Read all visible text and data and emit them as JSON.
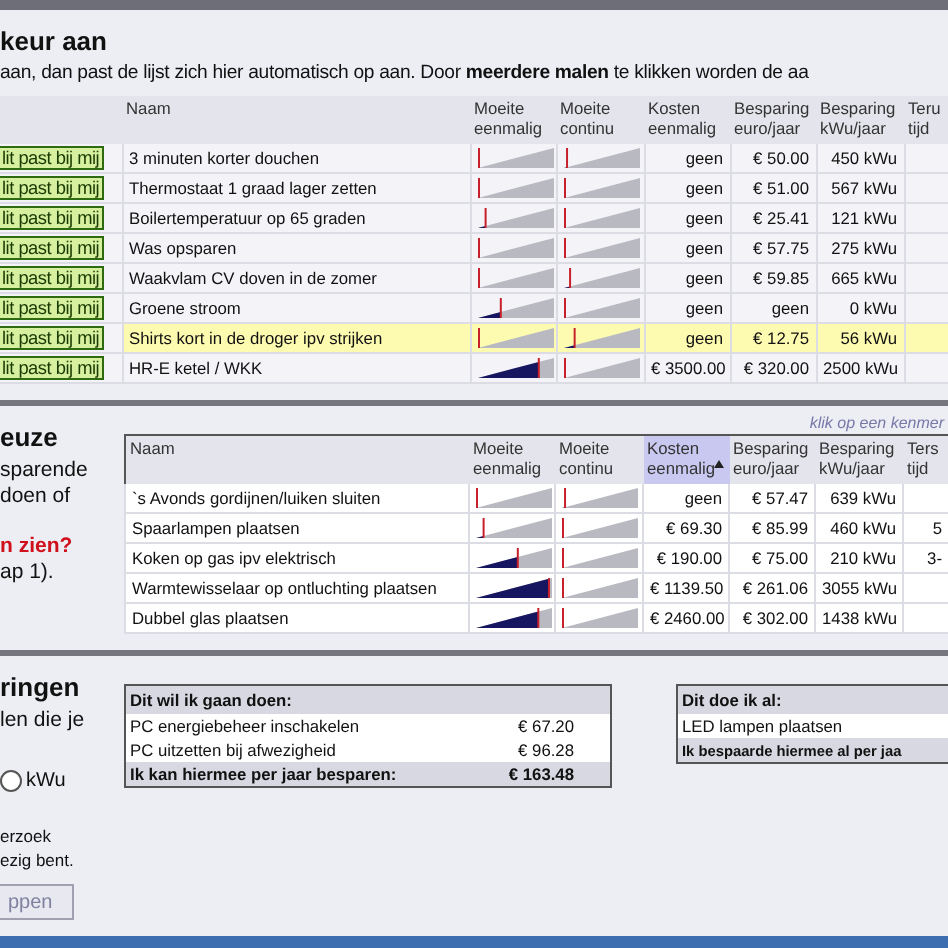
{
  "top": {
    "heading": "keur aan",
    "intro": "aan, dan past de lijst zich hier automatisch op aan. Door **meerdere malen** te klikken worden de aa"
  },
  "table1": {
    "columns": [
      {
        "sorted": false
      },
      {
        "label": "Naam",
        "sorted": false
      },
      {
        "label": "Moeite eenmalig",
        "sorted": false
      },
      {
        "label": "Moeite continu",
        "sorted": false
      },
      {
        "label": "Kosten eenmalig",
        "sorted": false
      },
      {
        "label": "Besparing euro/jaar",
        "sorted": false
      },
      {
        "label": "Besparing kWu/jaar",
        "sorted": false
      },
      {
        "label": "Teru tijd",
        "sorted": false
      }
    ],
    "rows": [
      {
        "button": "lit past bij mij",
        "name": "3 minuten korter douchen",
        "effort_once": {
          "level": 0
        },
        "effort_continuous": {
          "level": 0.04
        },
        "cost": "geen",
        "saving_euro": "€ 50.00",
        "saving_kwu": "450 kWu",
        "highlighted": false
      },
      {
        "button": "lit past bij mij",
        "name": "Thermostaat 1 graad lager zetten",
        "effort_once": {
          "level": 0
        },
        "effort_continuous": {
          "level": 0
        },
        "cost": "geen",
        "saving_euro": "€ 51.00",
        "saving_kwu": "567 kWu",
        "highlighted": false
      },
      {
        "button": "lit past bij mij",
        "name": "Boilertemperatuur op 65 graden",
        "effort_once": {
          "level": 0.1
        },
        "effort_continuous": {
          "level": 0
        },
        "cost": "geen",
        "saving_euro": "€ 25.41",
        "saving_kwu": "121 kWu",
        "highlighted": false
      },
      {
        "button": "lit past bij mij",
        "name": "Was opsparen",
        "effort_once": {
          "level": 0
        },
        "effort_continuous": {
          "level": 0
        },
        "cost": "geen",
        "saving_euro": "€ 57.75",
        "saving_kwu": "275 kWu",
        "highlighted": false
      },
      {
        "button": "lit past bij mij",
        "name": "Waakvlam CV doven in de zomer",
        "effort_once": {
          "level": 0
        },
        "effort_continuous": {
          "level": 0.08
        },
        "cost": "geen",
        "saving_euro": "€ 59.85",
        "saving_kwu": "665 kWu",
        "highlighted": false
      },
      {
        "button": "lit past bij mij",
        "name": "Groene stroom",
        "effort_once": {
          "level": 0.3
        },
        "effort_continuous": {
          "level": 0
        },
        "cost": "geen",
        "saving_euro": "geen",
        "saving_kwu": "0 kWu",
        "highlighted": false
      },
      {
        "button": "lit past bij mij",
        "name": "Shirts kort in de droger ipv strijken",
        "effort_once": {
          "level": 0
        },
        "effort_continuous": {
          "level": 0.14
        },
        "cost": "geen",
        "saving_euro": "€ 12.75",
        "saving_kwu": "56 kWu",
        "highlighted": true
      },
      {
        "button": "lit past bij mij",
        "name": "HR-E ketel / WKK",
        "effort_once": {
          "level": 0.8
        },
        "effort_continuous": {
          "level": 0
        },
        "cost": "€ 3500.00",
        "saving_euro": "€ 320.00",
        "saving_kwu": "2500 kWu",
        "highlighted": false
      }
    ]
  },
  "section2": {
    "heading": "euze",
    "lines": [
      {
        "text": "sparende",
        "kind": "plain"
      },
      {
        "text": "doen of",
        "kind": "plain"
      },
      {
        "text": "n zien?",
        "kind": "alert"
      },
      {
        "text": "ap 1).",
        "kind": "plain"
      }
    ],
    "hint": "klik op een kenmer"
  },
  "table2": {
    "columns": [
      {
        "label": "Naam",
        "sorted": false
      },
      {
        "label": "Moeite eenmalig",
        "sorted": false
      },
      {
        "label": "Moeite continu",
        "sorted": false
      },
      {
        "label": "Kosten eenmalig",
        "sorted": true
      },
      {
        "label": "Besparing euro/jaar",
        "sorted": false
      },
      {
        "label": "Besparing kWu/jaar",
        "sorted": false
      },
      {
        "label": "Ters tijd",
        "sorted": false
      }
    ],
    "rows": [
      {
        "name": "`s Avonds gordijnen/luiken sluiten",
        "effort_once": {
          "level": 0
        },
        "effort_continuous": {
          "level": 0.04
        },
        "cost": "geen",
        "saving_euro": "€ 57.47",
        "saving_kwu": "639 kWu"
      },
      {
        "name": "Spaarlampen plaatsen",
        "effort_once": {
          "level": 0.1
        },
        "effort_continuous": {
          "level": 0
        },
        "cost": "€ 69.30",
        "saving_euro": "€ 85.99",
        "saving_kwu": "460 kWu",
        "column_8": "5"
      },
      {
        "name": "Koken op gas ipv elektrisch",
        "effort_once": {
          "level": 0.55
        },
        "effort_continuous": {
          "level": 0
        },
        "cost": "€ 190.00",
        "saving_euro": "€ 75.00",
        "saving_kwu": "210 kWu",
        "column_8": "3-"
      },
      {
        "name": "Warmtewisselaar op ontluchting plaatsen",
        "effort_once": {
          "level": 0.96
        },
        "effort_continuous": {
          "level": 0
        },
        "cost": "€ 1139.50",
        "saving_euro": "€ 261.06",
        "saving_kwu": "3055 kWu"
      },
      {
        "name": "Dubbel glas plaatsen",
        "effort_once": {
          "level": 0.82
        },
        "effort_continuous": {
          "level": 0
        },
        "cost": "€ 2460.00",
        "saving_euro": "€ 302.00",
        "saving_kwu": "1438 kWu"
      }
    ]
  },
  "section3": {
    "heading": "ringen",
    "line": "len die je",
    "radio": {
      "label": "kWu",
      "checked": false
    },
    "notes": [
      "erzoek",
      "ezig bent."
    ],
    "button": "ppen"
  },
  "plan": {
    "title": "Dit wil ik gaan doen:",
    "rows": [
      {
        "name": "PC energiebeheer inschakelen",
        "amount": "€ 67.20"
      },
      {
        "name": "PC uitzetten bij afwezigheid",
        "amount": "€ 96.28"
      }
    ],
    "total_label": "Ik kan hiermee per jaar besparen:",
    "total": "€ 163.48"
  },
  "done": {
    "title": "Dit doe ik al:",
    "rows": [
      {
        "name": "LED lampen plaatsen"
      }
    ],
    "total_label": "Ik bespaarde hiermee al per jaa"
  }
}
